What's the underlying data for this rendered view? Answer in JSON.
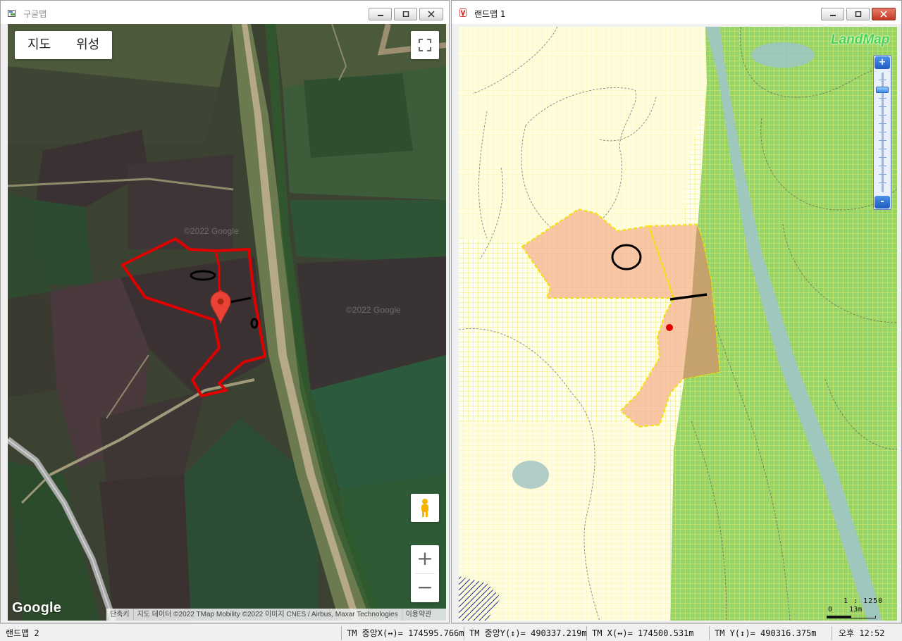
{
  "left_window": {
    "title": "구글맵",
    "map_types": [
      "지도",
      "위성"
    ],
    "logo": "Google",
    "attribution": [
      "단축키",
      "지도 데이터 ©2022 TMap Mobility ©2022 이미지 CNES / Airbus, Maxar Technologies",
      "이용약관"
    ],
    "watermark": "©2022 Google",
    "zoom_in": "+",
    "zoom_out": "−"
  },
  "right_window": {
    "title": "랜드맵 1",
    "logo": "LandMap",
    "scale_ratio": "1 : 1250",
    "scale_bar_label": "0    13m",
    "zoom_in": "+",
    "zoom_out": "-"
  },
  "statusbar": {
    "window_name": "랜드맵 2",
    "tm_center_x": "TM 중앙X(↔)= 174595.766m",
    "tm_center_y": "TM 중앙Y(↕)= 490337.219m",
    "tm_x": "TM X(↔)= 174500.531m",
    "tm_y": "TM Y(↕)= 490316.375m",
    "clock": "오후 12:52"
  },
  "colors": {
    "parcel_outline": "#e00000",
    "parcel_fill_landmap": "#f7c8a8",
    "landmap_yellow_grid": "#f4f07a",
    "landmap_green": "#96d46a",
    "river": "#9ec5c8",
    "marker_red": "#e53935"
  }
}
